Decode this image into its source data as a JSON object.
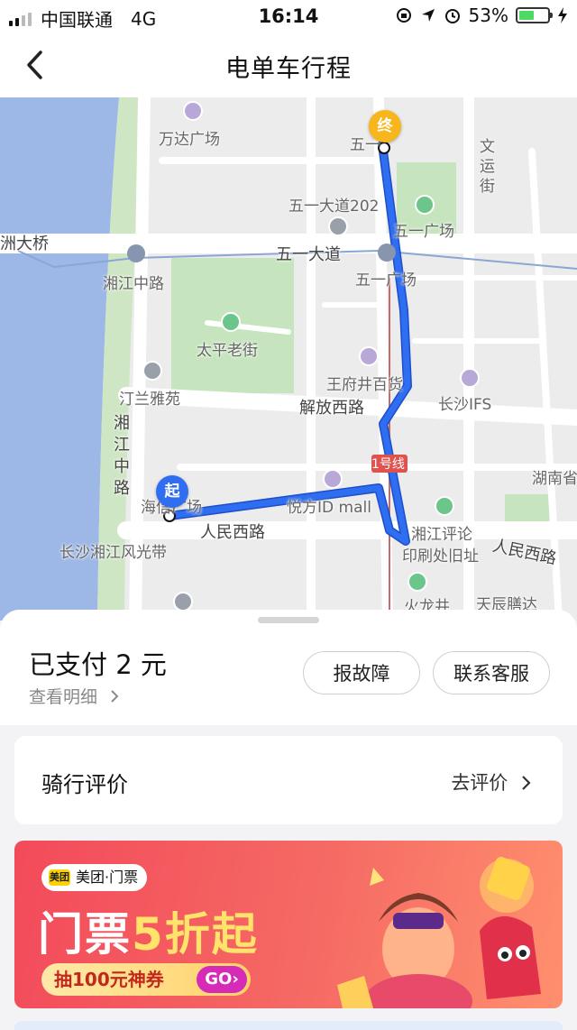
{
  "status_bar": {
    "carrier": "中国联通",
    "network": "4G",
    "time": "16:14",
    "battery_percent": "53%",
    "battery_level": 0.53
  },
  "nav": {
    "title": "电单车行程"
  },
  "map": {
    "labels": {
      "wanda": "万达广场",
      "wuyi_top": "五一",
      "wenyun": "文运街",
      "wuyi_dadao_202": "五一大道202",
      "wuyi_square": "五一广场",
      "bridge": "洲大桥",
      "wuyi_dadao": "五一大道",
      "xiangjiang_zhonglu_station": "湘江中路",
      "wuyi_square_2": "五一广场",
      "taiping": "太平老街",
      "wangfujing": "王府井百货",
      "tinglan": "汀兰雅苑",
      "jiefang": "解放西路",
      "ifs": "长沙IFS",
      "xiangjiang_vertical": "湘江中路",
      "line1": "1号线",
      "hunan": "湖南省",
      "haixin": "海信广场",
      "id_mall": "悦方ID mall",
      "renmin": "人民西路",
      "pinglun": "湘江评论",
      "printing": "印刷处旧址",
      "renmin_right": "人民西路",
      "scenic": "长沙湘江风光带",
      "huolong": "火龙井",
      "tianchen": "天辰膳达"
    },
    "start_pin": "起",
    "end_pin": "终",
    "route_color": "#2f6df1"
  },
  "trip": {
    "paid": "已支付 2 元",
    "detail": "查看明细",
    "report_button": "报故障",
    "service_button": "联系客服"
  },
  "rating": {
    "title": "骑行评价",
    "link": "去评价"
  },
  "banner": {
    "brand": "美团·门票",
    "brand_logo": "美团",
    "headline_main": "门票",
    "headline_accent": "5折起",
    "coupon": "抽100元神券",
    "go": "GO›"
  }
}
